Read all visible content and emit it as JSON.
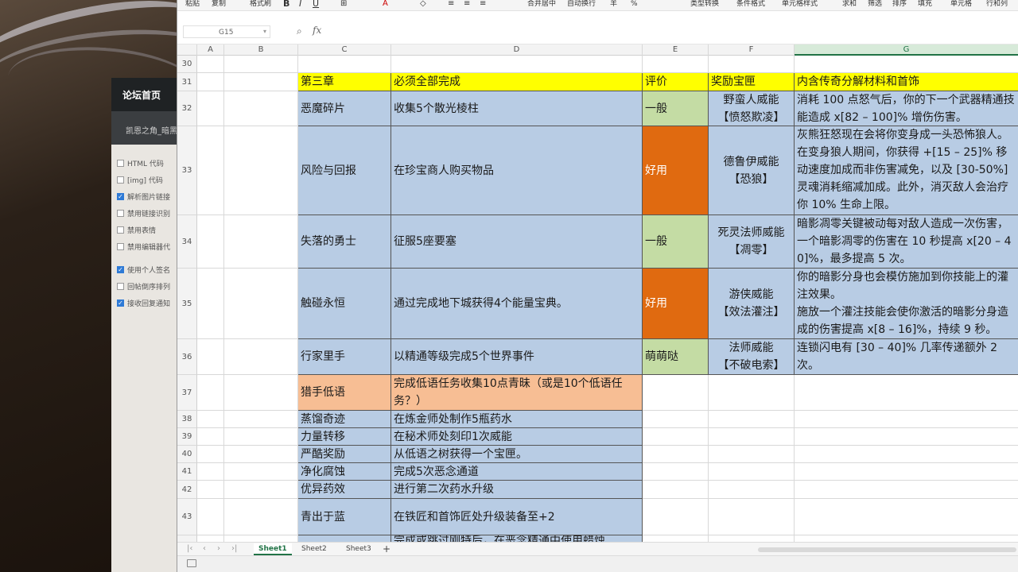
{
  "forum": {
    "nav_home": "论坛首页",
    "breadcrumb": "凯恩之角_暗黑",
    "options": [
      {
        "label": "HTML 代码",
        "checked": false
      },
      {
        "label": "[img] 代码",
        "checked": false
      },
      {
        "label": "解析图片链接",
        "checked": true
      },
      {
        "label": "禁用链接识别",
        "checked": false
      },
      {
        "label": "禁用表情",
        "checked": false
      },
      {
        "label": "禁用编辑器代",
        "checked": false
      },
      {
        "label": "使用个人签名",
        "checked": true
      },
      {
        "label": "回帖倒序排列",
        "checked": false
      },
      {
        "label": "接收回复通知",
        "checked": true
      }
    ]
  },
  "toolbar": {
    "paste": "粘贴",
    "copy": "复制",
    "format_painter": "格式刷",
    "bold": "B",
    "italic": "I",
    "underline": "U",
    "merge_center": "合并居中",
    "wrap_text": "自动换行",
    "currency": "羊",
    "percent": "%",
    "type_convert": "类型转换",
    "conditional_format": "条件格式",
    "cell_style": "单元格样式",
    "sum": "求和",
    "filter": "筛选",
    "sort": "排序",
    "fill": "填充",
    "cell": "单元格",
    "rows_cols": "行和列"
  },
  "formula_bar": {
    "name_box": "G15",
    "fx": "fx",
    "formula": ""
  },
  "columns": [
    "A",
    "B",
    "C",
    "D",
    "E",
    "F",
    "G"
  ],
  "selected_column": "G",
  "rows": [
    {
      "num": "30"
    },
    {
      "num": "31",
      "C": "第三章",
      "D": "必须全部完成",
      "E": "评价",
      "F": "奖励宝匣",
      "G": "内含传奇分解材料和首饰"
    },
    {
      "num": "32",
      "C": "恶魔碎片",
      "D": "收集5个散光棱柱",
      "E": "一般",
      "F": "野蛮人威能\n【愤怒欺凌】",
      "G": "消耗 100 点怒气后，你的下一个武器精通技能造成 x[82 – 100]% 增伤伤害。"
    },
    {
      "num": "33",
      "C": "风险与回报",
      "D": "在珍宝商人购买物品",
      "E": "好用",
      "F": "德鲁伊威能\n【恐狼】",
      "G": "灰熊狂怒现在会将你变身成一头恐怖狼人。在变身狼人期间，你获得 +[15 – 25]% 移动速度加成而非伤害减免，以及 [30-50%] 灵魂消耗缩减加成。此外，消灭敌人会治疗你 10% 生命上限。"
    },
    {
      "num": "34",
      "C": "失落的勇士",
      "D": "征服5座要塞",
      "E": "一般",
      "F": "死灵法师威能\n【凋零】",
      "G": "暗影凋零关键被动每对敌人造成一次伤害，一个暗影凋零的伤害在 10 秒提高 x[20 – 40]%，最多提高 5 次。"
    },
    {
      "num": "35",
      "C": "触碰永恒",
      "D": "通过完成地下城获得4个能量宝典。",
      "E": "好用",
      "F": "游侠威能\n【效法灌注】",
      "G": "你的暗影分身也会模仿施加到你技能上的灌注效果。\n施放一个灌注技能会使你激活的暗影分身造成的伤害提高 x[8 – 16]%，持续 9 秒。"
    },
    {
      "num": "36",
      "C": "行家里手",
      "D": "以精通等级完成5个世界事件",
      "E": "萌萌哒",
      "F": "法师威能\n【不破电索】",
      "G": "连锁闪电有 [30 – 40]% 几率传递额外 2 次。"
    },
    {
      "num": "37",
      "C": "猎手低语",
      "D": "完成低语任务收集10点青昧（或是10个低语任务？）"
    },
    {
      "num": "38",
      "C": "蒸馏奇迹",
      "D": "在炼金师处制作5瓶药水"
    },
    {
      "num": "39",
      "C": "力量转移",
      "D": "在秘术师处刻印1次威能"
    },
    {
      "num": "40",
      "C": "严酷奖励",
      "D": "从低语之树获得一个宝匣。"
    },
    {
      "num": "41",
      "C": "净化腐蚀",
      "D": "完成5次恶念通道"
    },
    {
      "num": "42",
      "C": "优异药效",
      "D": "进行第二次药水升级"
    },
    {
      "num": "43",
      "C": "青出于蓝",
      "D": "在铁匠和首饰匠处升级装备至+2"
    },
    {
      "num": "44",
      "C": "",
      "D": "完成或跳过刚特后，在恶念精通中使用蜡烛"
    }
  ],
  "sheets": {
    "tab1": "Sheet1",
    "tab2": "Sheet2",
    "tab3": "Sheet3",
    "add": "+"
  },
  "colors": {
    "yellow": "#ffff00",
    "blue": "#b8cce4",
    "green": "#c4dca4",
    "orange": "#e06a10",
    "peach": "#f7be94",
    "accent": "#217346"
  }
}
